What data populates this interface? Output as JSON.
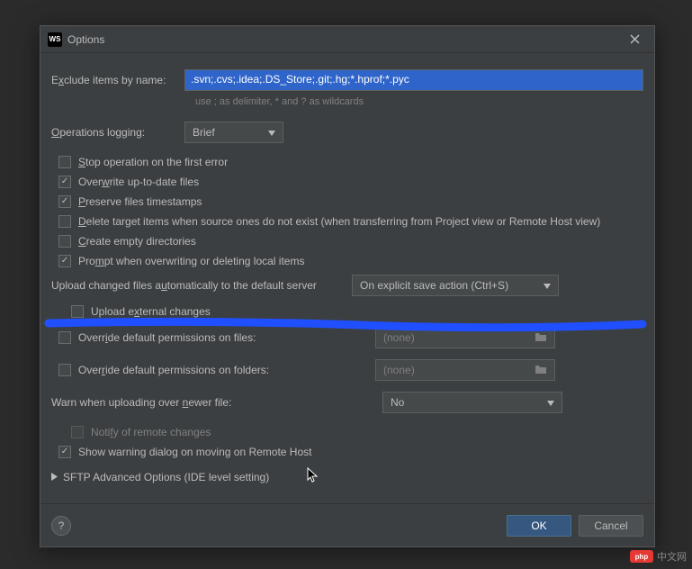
{
  "title": "Options",
  "exclude": {
    "label_pre": "E",
    "label_u": "x",
    "label_post": "clude items by name:",
    "value": ".svn;.cvs;.idea;.DS_Store;.git;.hg;*.hprof;*.pyc",
    "hint": "use ; as delimiter, * and ? as wildcards"
  },
  "logging": {
    "label_u": "O",
    "label_post": "perations logging:",
    "value": "Brief"
  },
  "checks": {
    "stop_u": "S",
    "stop_post": "top operation on the first error",
    "overwrite_pre": "Over",
    "overwrite_u": "w",
    "overwrite_post": "rite up-to-date files",
    "preserve_u": "P",
    "preserve_post": "reserve files timestamps",
    "delete_u": "D",
    "delete_post": "elete target items when source ones do not exist (when transferring from Project view or Remote Host view)",
    "create_u": "C",
    "create_post": "reate empty directories",
    "prompt_pre": "Pro",
    "prompt_u": "m",
    "prompt_post": "pt when overwriting or deleting local items"
  },
  "upload": {
    "label_pre": "Upload changed files a",
    "label_u": "u",
    "label_post": "tomatically to the default server",
    "value": "On explicit save action (Ctrl+S)"
  },
  "external": {
    "pre": "Upload e",
    "u": "x",
    "post": "ternal changes"
  },
  "perm_files": {
    "pre": "Overr",
    "u": "i",
    "post": "de default permissions on files:",
    "value": "(none)"
  },
  "perm_folders": {
    "pre": "Over",
    "u": "r",
    "post": "ide default permissions on folders:",
    "value": "(none)"
  },
  "warn": {
    "pre": "Warn when uploading over ",
    "u": "n",
    "post": "ewer file:",
    "value": "No"
  },
  "notify": {
    "pre": "Noti",
    "u": "f",
    "post": "y of remote changes"
  },
  "show_warning": {
    "pre": "Show warning dialog on moving on Remote Host"
  },
  "sftp_expand": "SFTP Advanced Options (IDE level setting)",
  "buttons": {
    "ok": "OK",
    "cancel": "Cancel"
  },
  "watermark": {
    "logo": "php",
    "text": "中文网"
  }
}
